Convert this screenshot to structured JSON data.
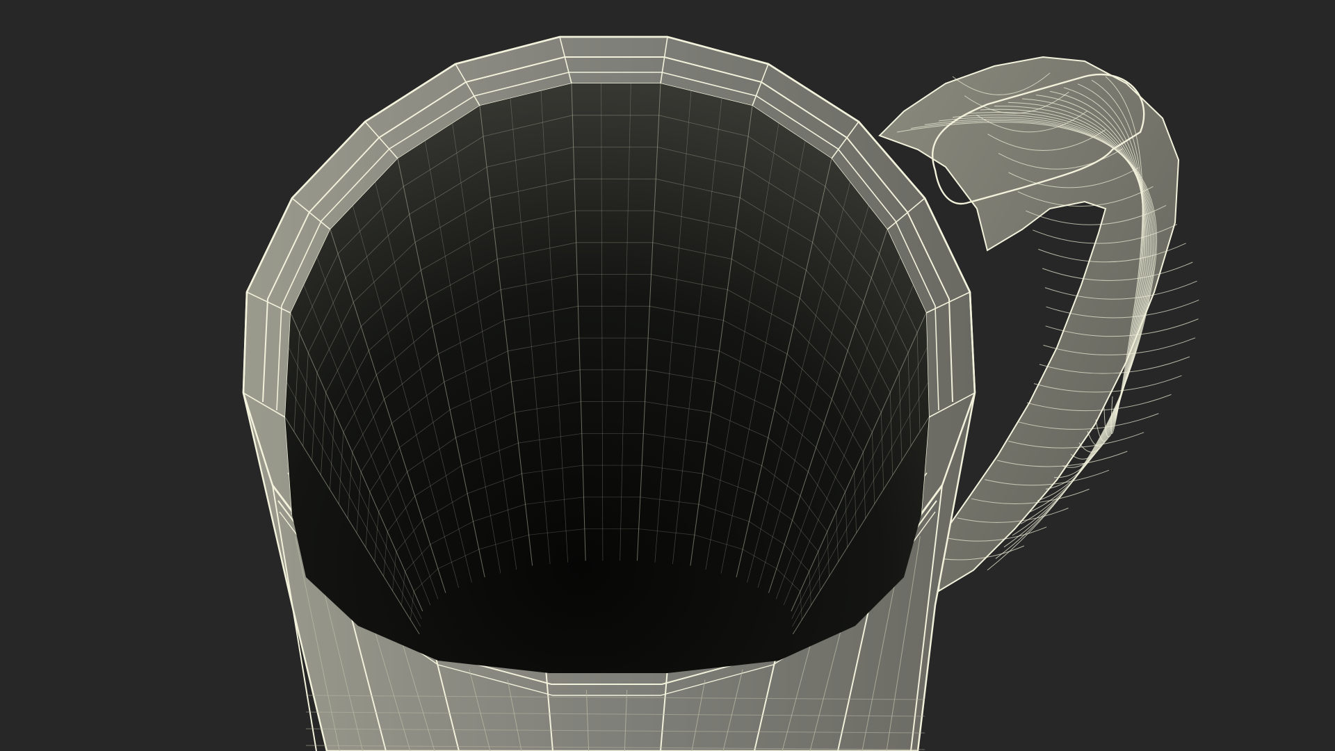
{
  "viewport": {
    "background_color": "#272727",
    "object": "wireframe-mug",
    "render_mode": "wireframe-on-shaded",
    "colors": {
      "shell_light": "#8a8a7e",
      "shell_dark": "#5d5d55",
      "interior_top": "#3a3b35",
      "interior_bottom": "#0a0a09",
      "wire": "#f2f2dc",
      "wire_dim": "#b8b8a4"
    }
  }
}
